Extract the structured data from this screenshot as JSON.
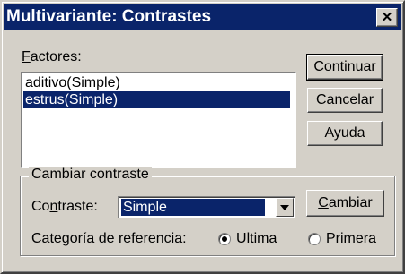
{
  "window": {
    "title": "Multivariante: Contrastes",
    "close_glyph": "✕"
  },
  "factors": {
    "label_accel": "F",
    "label_rest": "actores:",
    "items": [
      {
        "label": "aditivo(Simple)",
        "selected": false
      },
      {
        "label": "estrus(Simple)",
        "selected": true
      }
    ]
  },
  "buttons": {
    "continue": "Continuar",
    "cancel": "Cancelar",
    "help": "Ayuda"
  },
  "change_group": {
    "title": "Cambiar contraste",
    "contrast_label_pre": "Co",
    "contrast_label_accel": "n",
    "contrast_label_post": "traste:",
    "contrast_value": "Simple",
    "change_button_accel": "C",
    "change_button_rest": "ambiar",
    "reference_label": "Categoría de referencia:",
    "option_last_accel": "U",
    "option_last_rest": "ltima",
    "option_first_pre": "P",
    "option_first_accel": "r",
    "option_first_post": "imera",
    "selected_option": "Ultima"
  }
}
